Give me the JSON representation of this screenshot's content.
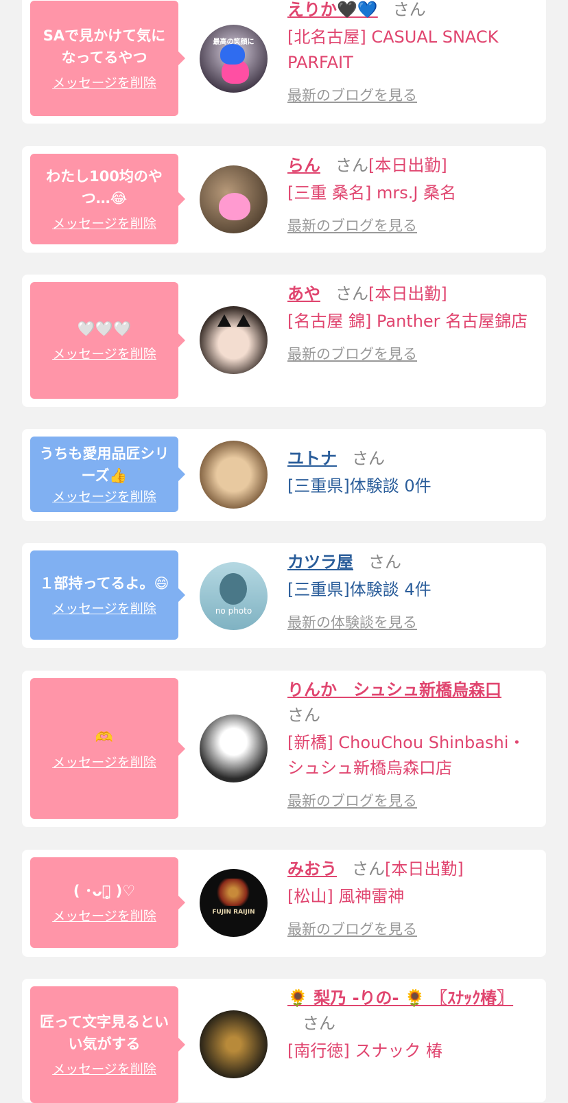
{
  "delete_label": "メッセージを削除",
  "honorific": "さん",
  "colors": {
    "pink_bubble": "#ff95a8",
    "blue_bubble": "#80b0f2",
    "pink_text": "#e0456f",
    "blue_text": "#2a5d9a",
    "link_gray": "#999999"
  },
  "items": [
    {
      "message": "SAで見かけて気になってるやつ",
      "name": "えりか🖤💙",
      "duty": "",
      "shop": "[北名古屋] CASUAL SNACK PARFAIT",
      "link": "最新のブログを見る",
      "avatar_text": "最高の笑顔に"
    },
    {
      "message": "わたし100均のやつ…😂",
      "name": "らん",
      "duty": "[本日出勤]",
      "shop": "[三重 桑名] mrs.J 桑名",
      "link": "最新のブログを見る"
    },
    {
      "message": "🤍🤍🤍",
      "name": "あや",
      "duty": "[本日出勤]",
      "shop": "[名古屋 錦] Panther 名古屋錦店",
      "link": "最新のブログを見る"
    },
    {
      "message": "うちも愛用品匠シリーズ👍",
      "name": "ユトナ",
      "duty": "",
      "shop": "[三重県]体験談 0件",
      "link": ""
    },
    {
      "message": "１部持ってるよ。😄",
      "name": "カツラ屋",
      "duty": "",
      "shop": "[三重県]体験談 4件",
      "link": "最新の体験談を見る",
      "avatar_text": "no photo"
    },
    {
      "message": "🫶",
      "name": "りんか　シュシュ新橋烏森口",
      "duty": "",
      "shop": "[新橋] ChouChou Shinbashi・シュシュ新橋烏森口店",
      "link": "最新のブログを見る"
    },
    {
      "message": "( ･ᴗ･̥̥̥ )♡",
      "name": "みおう",
      "duty": "[本日出勤]",
      "shop": "[松山] 風神雷神",
      "link": "最新のブログを見る",
      "avatar_text": "FUJIN RAIJIN"
    },
    {
      "message": "匠って文字見るといい気がする",
      "name": "🌻 梨乃 -りの- 🌻 〖ｽﾅｯｸ椿〗",
      "duty": "",
      "shop": "[南行徳] スナック 椿",
      "link": ""
    }
  ]
}
